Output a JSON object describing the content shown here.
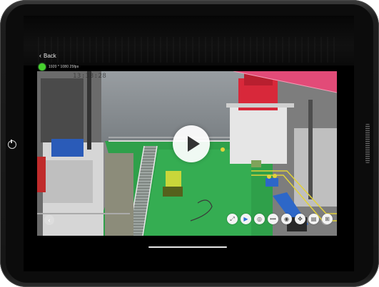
{
  "header": {
    "back_label": "Back",
    "stream_info": "1920 * 1080 25fps"
  },
  "video": {
    "timestamp_overlay": "13:38:28"
  },
  "controls": [
    {
      "name": "fullscreen-icon",
      "glyph": "⤢"
    },
    {
      "name": "play-icon",
      "glyph": "▶"
    },
    {
      "name": "record-icon",
      "glyph": "◎"
    },
    {
      "name": "more-icon",
      "glyph": "•••"
    },
    {
      "name": "camera-icon",
      "glyph": "◉"
    },
    {
      "name": "ptz-icon",
      "glyph": "✥"
    },
    {
      "name": "message-icon",
      "glyph": "▤"
    },
    {
      "name": "grid-icon",
      "glyph": "⊞"
    }
  ],
  "colors": {
    "status_dot": "#46d12d",
    "deck_green": "#2fa04a",
    "crane_red": "#d8283a",
    "crane_pink": "#e24b78"
  }
}
